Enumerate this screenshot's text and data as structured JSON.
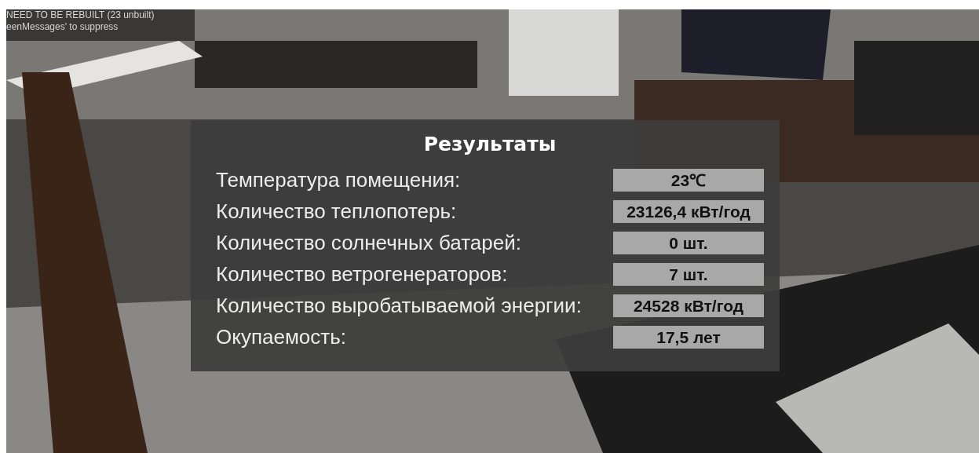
{
  "debug_messages": [
    "NEED TO BE REBUILT (23 unbuilt)",
    "eenMessages' to suppress"
  ],
  "results_panel": {
    "title": "Результаты",
    "rows": [
      {
        "label": "Температура помещения:",
        "value": "23℃"
      },
      {
        "label": "Количество теплопотерь:",
        "value": "23126,4 кВт/год"
      },
      {
        "label": "Количество солнечных батарей:",
        "value": "0 шт."
      },
      {
        "label": "Количество ветрогенераторов:",
        "value": "7 шт."
      },
      {
        "label": "Количество выробатываемой энергии:",
        "value": "24528 кВт/год"
      },
      {
        "label": "Окупаемость:",
        "value": "17,5 лет"
      }
    ]
  }
}
